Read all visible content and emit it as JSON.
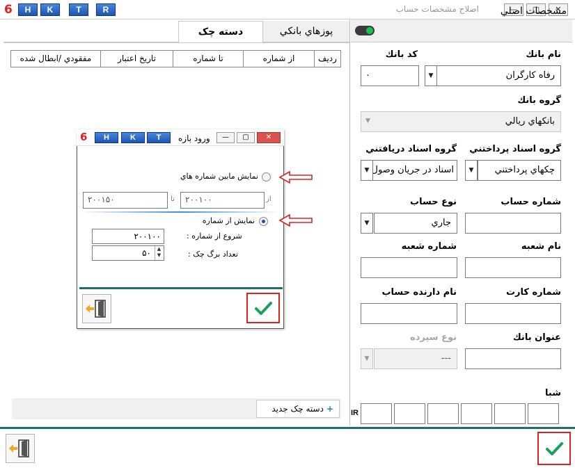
{
  "window": {
    "title": "اصلاح مشخصات حساب",
    "hk_buttons": [
      "H",
      "K",
      "T",
      "R"
    ],
    "controls": [
      "—",
      "▢",
      "✕"
    ]
  },
  "tabs": [
    {
      "label": "دسته چک",
      "active": true
    },
    {
      "label": "پوزهاي بانكي",
      "active": false
    }
  ],
  "grid": {
    "columns": [
      "رديف",
      "از شماره",
      "تا شماره",
      "تاريخ اعتبار",
      "مفقودي /ابطال شده"
    ]
  },
  "new_checkbook_button": "دسته چک جديد",
  "main_panel": {
    "title": "مشخصات اصلي",
    "bank_name": {
      "label": "نام بانك",
      "value": "رفاه كارگران"
    },
    "bank_code": {
      "label": "كد بانك",
      "value": "۰"
    },
    "bank_group": {
      "label": "گروه بانك",
      "value": "بانكهاي ريالي"
    },
    "payment_docs_group": {
      "label": "گروه اسناد پرداختني",
      "value": "چكهاي پرداختني"
    },
    "receive_docs_group": {
      "label": "گروه اسناد دريافتني",
      "value": "اسناد در جريان وصول"
    },
    "account_number": {
      "label": "شماره حساب",
      "value": ""
    },
    "account_type": {
      "label": "نوع حساب",
      "value": "جاري"
    },
    "branch_name": {
      "label": "نام شعبه",
      "value": ""
    },
    "branch_number": {
      "label": "شماره شعبه",
      "value": ""
    },
    "card_number": {
      "label": "شماره كارت",
      "value": ""
    },
    "holder_name": {
      "label": "نام دارنده حساب",
      "value": ""
    },
    "bank_title": {
      "label": "عنوان بانك",
      "value": ""
    },
    "deposit_type": {
      "label": "نوع سپرده",
      "value": "---"
    },
    "sheba": {
      "label": "شبا",
      "prefix": "IR"
    }
  },
  "dialog": {
    "title": "ورود بازه",
    "hk_buttons": [
      "H",
      "K",
      "T"
    ],
    "controls": [
      "—",
      "▢",
      "✕"
    ],
    "option_range": "نمايش مابين شماره هاي",
    "from_label": "از",
    "from_value": "۲۰۰۱۰۰",
    "to_label": "تا",
    "to_value": "۲۰۰۱۵۰",
    "option_from": "نمايش از شماره",
    "start_label": "شروع از شماره :",
    "start_value": "۲۰۰۱۰۰",
    "count_label": "تعداد برگ چک   :",
    "count_value": "۵۰"
  },
  "colors": {
    "accent_teal": "#1f6f6b",
    "ok_green": "#1aa05a",
    "highlight_red": "#e02020",
    "toggle_on": "#19c24a"
  }
}
